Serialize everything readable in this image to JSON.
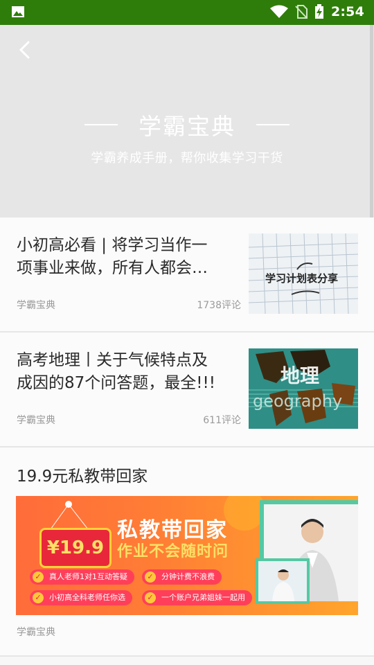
{
  "status_bar": {
    "time": "2:54"
  },
  "header": {
    "title": "学霸宝典",
    "subtitle": "学霸养成手册，帮你收集学习干货"
  },
  "articles": [
    {
      "title_line1": "小初高必看 | 将学习当作一",
      "title_line2": "项事业来做，所有人都会…",
      "source": "学霸宝典",
      "comments": "1738评论",
      "image_text": "学习计划表分享"
    },
    {
      "title_line1": "高考地理丨关于气候特点及",
      "title_line2": "成因的87个问答题，最全!!!",
      "source": "学霸宝典",
      "comments": "611评论",
      "image_text1": "地理",
      "image_text2": "geography"
    },
    {
      "title": "19.9元私教带回家",
      "source": "学霸宝典",
      "banner": {
        "price": "¥19.9",
        "headline1": "私教带回家",
        "headline2": "作业不会随时问",
        "features": [
          "真人老师1对1互动答疑",
          "分钟计费不浪费",
          "小初高全科老师任你选",
          "一个账户兄弟姐妹一起用"
        ]
      }
    }
  ]
}
